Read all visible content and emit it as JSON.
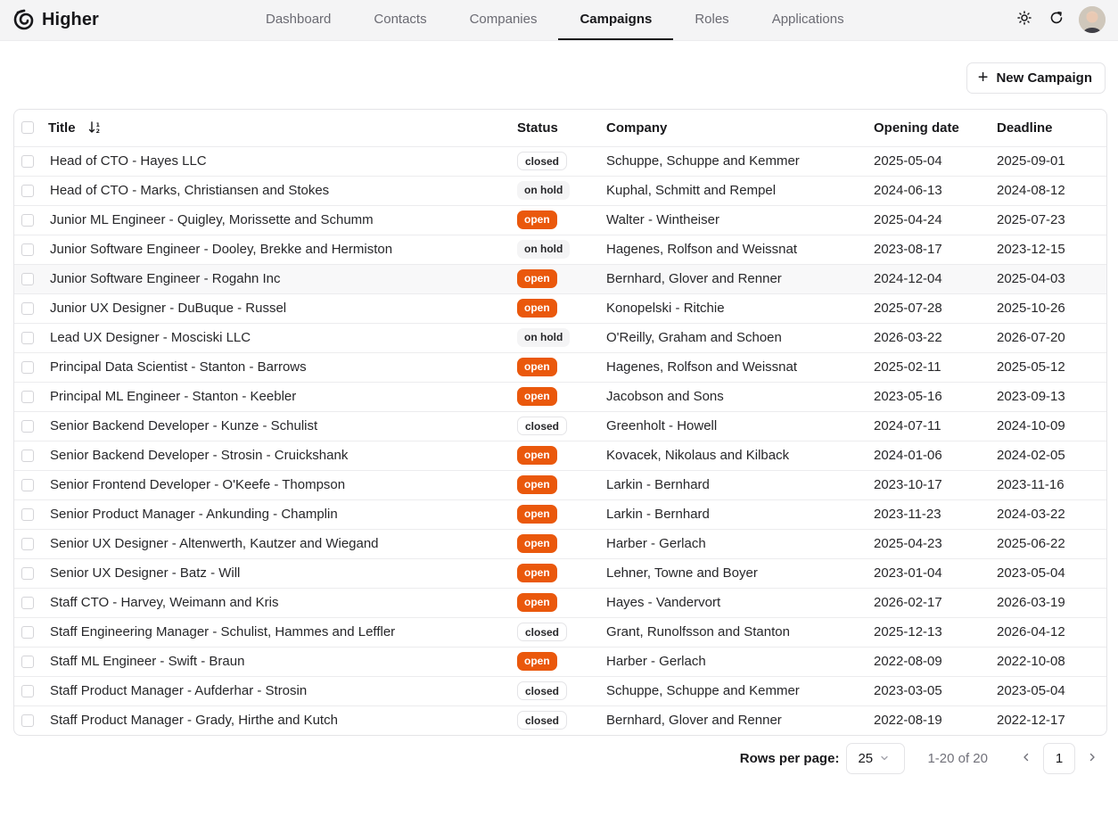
{
  "app": {
    "name": "Higher"
  },
  "nav": {
    "tabs": [
      {
        "label": "Dashboard"
      },
      {
        "label": "Contacts"
      },
      {
        "label": "Companies"
      },
      {
        "label": "Campaigns",
        "active": true
      },
      {
        "label": "Roles"
      },
      {
        "label": "Applications"
      }
    ]
  },
  "header": {
    "icons": [
      "sun-icon",
      "refresh-icon"
    ],
    "avatar": "user-avatar"
  },
  "toolbar": {
    "new_button_label": "New Campaign"
  },
  "table": {
    "columns": {
      "title": "Title",
      "status": "Status",
      "company": "Company",
      "opening_date": "Opening date",
      "deadline": "Deadline"
    },
    "rows": [
      {
        "title": "Head of CTO - Hayes LLC",
        "status": "closed",
        "company": "Schuppe, Schuppe and Kemmer",
        "opening_date": "2025-05-04",
        "deadline": "2025-09-01"
      },
      {
        "title": "Head of CTO - Marks, Christiansen and Stokes",
        "status": "on hold",
        "company": "Kuphal, Schmitt and Rempel",
        "opening_date": "2024-06-13",
        "deadline": "2024-08-12"
      },
      {
        "title": "Junior ML Engineer - Quigley, Morissette and Schumm",
        "status": "open",
        "company": "Walter - Wintheiser",
        "opening_date": "2025-04-24",
        "deadline": "2025-07-23"
      },
      {
        "title": "Junior Software Engineer - Dooley, Brekke and Hermiston",
        "status": "on hold",
        "company": "Hagenes, Rolfson and Weissnat",
        "opening_date": "2023-08-17",
        "deadline": "2023-12-15"
      },
      {
        "title": "Junior Software Engineer - Rogahn Inc",
        "status": "open",
        "company": "Bernhard, Glover and Renner",
        "opening_date": "2024-12-04",
        "deadline": "2025-04-03"
      },
      {
        "title": "Junior UX Designer - DuBuque - Russel",
        "status": "open",
        "company": "Konopelski - Ritchie",
        "opening_date": "2025-07-28",
        "deadline": "2025-10-26"
      },
      {
        "title": "Lead UX Designer - Mosciski LLC",
        "status": "on hold",
        "company": "O'Reilly, Graham and Schoen",
        "opening_date": "2026-03-22",
        "deadline": "2026-07-20"
      },
      {
        "title": "Principal Data Scientist - Stanton - Barrows",
        "status": "open",
        "company": "Hagenes, Rolfson and Weissnat",
        "opening_date": "2025-02-11",
        "deadline": "2025-05-12"
      },
      {
        "title": "Principal ML Engineer - Stanton - Keebler",
        "status": "open",
        "company": "Jacobson and Sons",
        "opening_date": "2023-05-16",
        "deadline": "2023-09-13"
      },
      {
        "title": "Senior Backend Developer - Kunze - Schulist",
        "status": "closed",
        "company": "Greenholt - Howell",
        "opening_date": "2024-07-11",
        "deadline": "2024-10-09"
      },
      {
        "title": "Senior Backend Developer - Strosin - Cruickshank",
        "status": "open",
        "company": "Kovacek, Nikolaus and Kilback",
        "opening_date": "2024-01-06",
        "deadline": "2024-02-05"
      },
      {
        "title": "Senior Frontend Developer - O'Keefe - Thompson",
        "status": "open",
        "company": "Larkin - Bernhard",
        "opening_date": "2023-10-17",
        "deadline": "2023-11-16"
      },
      {
        "title": "Senior Product Manager - Ankunding - Champlin",
        "status": "open",
        "company": "Larkin - Bernhard",
        "opening_date": "2023-11-23",
        "deadline": "2024-03-22"
      },
      {
        "title": "Senior UX Designer - Altenwerth, Kautzer and Wiegand",
        "status": "open",
        "company": "Harber - Gerlach",
        "opening_date": "2025-04-23",
        "deadline": "2025-06-22"
      },
      {
        "title": "Senior UX Designer - Batz - Will",
        "status": "open",
        "company": "Lehner, Towne and Boyer",
        "opening_date": "2023-01-04",
        "deadline": "2023-05-04"
      },
      {
        "title": "Staff CTO - Harvey, Weimann and Kris",
        "status": "open",
        "company": "Hayes - Vandervort",
        "opening_date": "2026-02-17",
        "deadline": "2026-03-19"
      },
      {
        "title": "Staff Engineering Manager - Schulist, Hammes and Leffler",
        "status": "closed",
        "company": "Grant, Runolfsson and Stanton",
        "opening_date": "2025-12-13",
        "deadline": "2026-04-12"
      },
      {
        "title": "Staff ML Engineer - Swift - Braun",
        "status": "open",
        "company": "Harber - Gerlach",
        "opening_date": "2022-08-09",
        "deadline": "2022-10-08"
      },
      {
        "title": "Staff Product Manager - Aufderhar - Strosin",
        "status": "closed",
        "company": "Schuppe, Schuppe and Kemmer",
        "opening_date": "2023-03-05",
        "deadline": "2023-05-04"
      },
      {
        "title": "Staff Product Manager - Grady, Hirthe and Kutch",
        "status": "closed",
        "company": "Bernhard, Glover and Renner",
        "opening_date": "2022-08-19",
        "deadline": "2022-12-17"
      }
    ]
  },
  "pagination": {
    "rows_per_page_label": "Rows per page:",
    "rows_per_page_value": "25",
    "range_text": "1-20 of 20",
    "current_page": "1"
  },
  "colors": {
    "open_badge": "#ea580c",
    "accent_text": "#18181b"
  }
}
